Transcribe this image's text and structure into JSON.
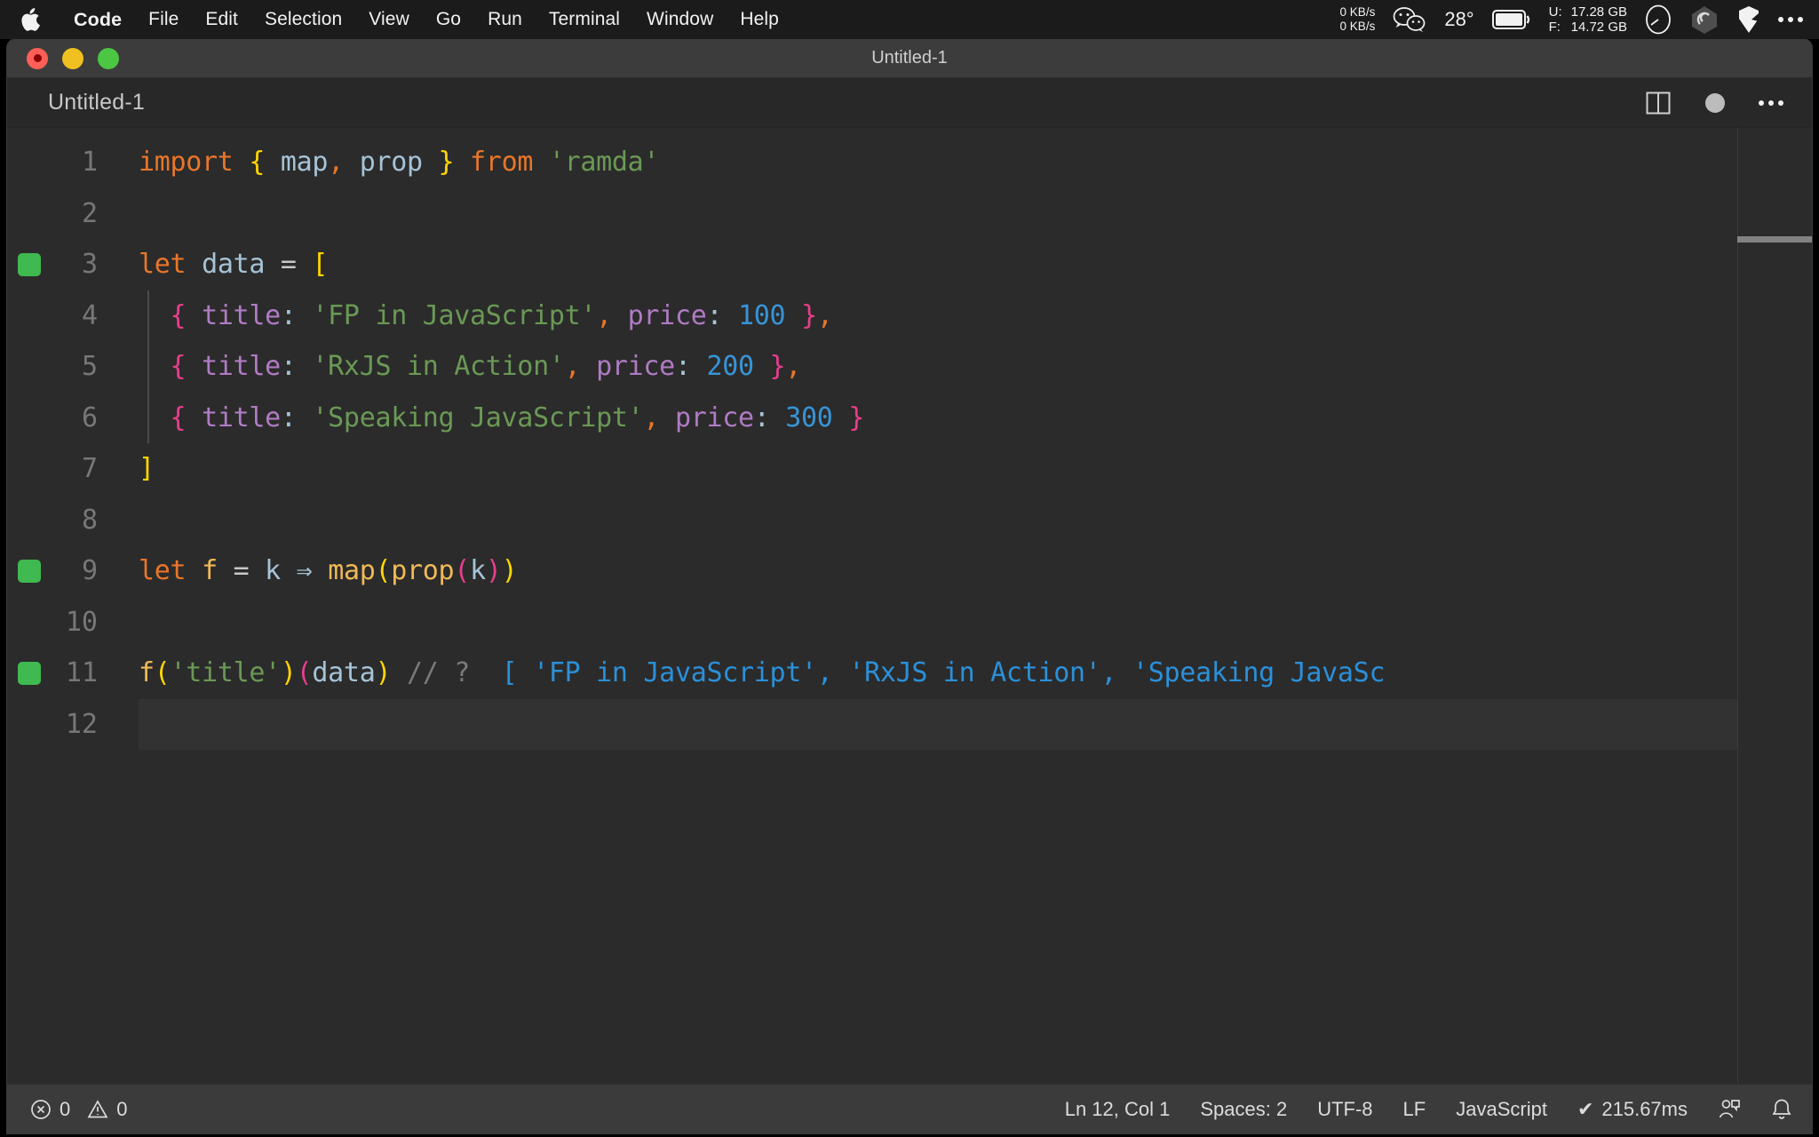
{
  "menubar": {
    "apple_icon": "apple-logo-icon",
    "items": [
      {
        "label": "Code",
        "bold": true
      },
      {
        "label": "File",
        "bold": false
      },
      {
        "label": "Edit",
        "bold": false
      },
      {
        "label": "Selection",
        "bold": false
      },
      {
        "label": "View",
        "bold": false
      },
      {
        "label": "Go",
        "bold": false
      },
      {
        "label": "Run",
        "bold": false
      },
      {
        "label": "Terminal",
        "bold": false
      },
      {
        "label": "Window",
        "bold": false
      },
      {
        "label": "Help",
        "bold": false
      }
    ],
    "status": {
      "net_up": "0 KB/s",
      "net_down": "0 KB/s",
      "wechat_icon": "wechat-icon",
      "temperature": "28°",
      "battery_icon": "battery-icon",
      "mem_used_label": "U:",
      "mem_used_value": "17.28 GB",
      "mem_free_label": "F:",
      "mem_free_value": "14.72 GB",
      "gauge_icon": "gauge-icon",
      "swirl_icon": "swirl-icon",
      "shield_icon": "shield-icon",
      "more_icon": "ellipsis-icon"
    }
  },
  "window": {
    "title": "Untitled-1",
    "traffic_lights": [
      {
        "name": "close-button",
        "color": "#ff5f57"
      },
      {
        "name": "minimize-button",
        "color": "#f0c020"
      },
      {
        "name": "maximize-button",
        "color": "#4cc744"
      }
    ]
  },
  "tabbar": {
    "tab_label": "Untitled-1",
    "split_editor_icon": "split-editor-icon",
    "dirty_indicator": "unsaved-dot-icon",
    "more_actions_icon": "ellipsis-icon"
  },
  "editor": {
    "lines": [
      {
        "number": "1",
        "marker": "",
        "indent_guide": false,
        "current": false,
        "tokens": [
          {
            "t": "import",
            "c": "kw"
          },
          {
            "t": " ",
            "c": "op"
          },
          {
            "t": "{",
            "c": "br-y"
          },
          {
            "t": " ",
            "c": "op"
          },
          {
            "t": "map",
            "c": "ident"
          },
          {
            "t": ",",
            "c": "kw"
          },
          {
            "t": " ",
            "c": "op"
          },
          {
            "t": "prop",
            "c": "ident"
          },
          {
            "t": " ",
            "c": "op"
          },
          {
            "t": "}",
            "c": "br-y"
          },
          {
            "t": " ",
            "c": "op"
          },
          {
            "t": "from",
            "c": "kw"
          },
          {
            "t": " ",
            "c": "op"
          },
          {
            "t": "'ramda'",
            "c": "str"
          }
        ]
      },
      {
        "number": "2",
        "marker": "",
        "indent_guide": false,
        "current": false,
        "tokens": []
      },
      {
        "number": "3",
        "marker": "green",
        "indent_guide": false,
        "current": false,
        "tokens": [
          {
            "t": "let",
            "c": "kw"
          },
          {
            "t": " ",
            "c": "op"
          },
          {
            "t": "data",
            "c": "ident"
          },
          {
            "t": " ",
            "c": "op"
          },
          {
            "t": "=",
            "c": "op"
          },
          {
            "t": " ",
            "c": "op"
          },
          {
            "t": "[",
            "c": "br-y"
          }
        ]
      },
      {
        "number": "4",
        "marker": "",
        "indent_guide": true,
        "current": false,
        "tokens": [
          {
            "t": "  ",
            "c": "op"
          },
          {
            "t": "{",
            "c": "br-m"
          },
          {
            "t": " ",
            "c": "op"
          },
          {
            "t": "title",
            "c": "prop"
          },
          {
            "t": ":",
            "c": "colon"
          },
          {
            "t": " ",
            "c": "op"
          },
          {
            "t": "'FP in JavaScript'",
            "c": "str"
          },
          {
            "t": ",",
            "c": "kw"
          },
          {
            "t": " ",
            "c": "op"
          },
          {
            "t": "price",
            "c": "prop"
          },
          {
            "t": ":",
            "c": "colon"
          },
          {
            "t": " ",
            "c": "op"
          },
          {
            "t": "100",
            "c": "num"
          },
          {
            "t": " ",
            "c": "op"
          },
          {
            "t": "}",
            "c": "br-m"
          },
          {
            "t": ",",
            "c": "kw"
          }
        ]
      },
      {
        "number": "5",
        "marker": "",
        "indent_guide": true,
        "current": false,
        "tokens": [
          {
            "t": "  ",
            "c": "op"
          },
          {
            "t": "{",
            "c": "br-m"
          },
          {
            "t": " ",
            "c": "op"
          },
          {
            "t": "title",
            "c": "prop"
          },
          {
            "t": ":",
            "c": "colon"
          },
          {
            "t": " ",
            "c": "op"
          },
          {
            "t": "'RxJS in Action'",
            "c": "str"
          },
          {
            "t": ",",
            "c": "kw"
          },
          {
            "t": " ",
            "c": "op"
          },
          {
            "t": "price",
            "c": "prop"
          },
          {
            "t": ":",
            "c": "colon"
          },
          {
            "t": " ",
            "c": "op"
          },
          {
            "t": "200",
            "c": "num"
          },
          {
            "t": " ",
            "c": "op"
          },
          {
            "t": "}",
            "c": "br-m"
          },
          {
            "t": ",",
            "c": "kw"
          }
        ]
      },
      {
        "number": "6",
        "marker": "",
        "indent_guide": true,
        "current": false,
        "tokens": [
          {
            "t": "  ",
            "c": "op"
          },
          {
            "t": "{",
            "c": "br-m"
          },
          {
            "t": " ",
            "c": "op"
          },
          {
            "t": "title",
            "c": "prop"
          },
          {
            "t": ":",
            "c": "colon"
          },
          {
            "t": " ",
            "c": "op"
          },
          {
            "t": "'Speaking JavaScript'",
            "c": "str"
          },
          {
            "t": ",",
            "c": "kw"
          },
          {
            "t": " ",
            "c": "op"
          },
          {
            "t": "price",
            "c": "prop"
          },
          {
            "t": ":",
            "c": "colon"
          },
          {
            "t": " ",
            "c": "op"
          },
          {
            "t": "300",
            "c": "num"
          },
          {
            "t": " ",
            "c": "op"
          },
          {
            "t": "}",
            "c": "br-m"
          }
        ]
      },
      {
        "number": "7",
        "marker": "",
        "indent_guide": false,
        "current": false,
        "tokens": [
          {
            "t": "]",
            "c": "br-y"
          }
        ]
      },
      {
        "number": "8",
        "marker": "",
        "indent_guide": false,
        "current": false,
        "tokens": []
      },
      {
        "number": "9",
        "marker": "green",
        "indent_guide": false,
        "current": false,
        "tokens": [
          {
            "t": "let",
            "c": "kw"
          },
          {
            "t": " ",
            "c": "op"
          },
          {
            "t": "f",
            "c": "fn"
          },
          {
            "t": " ",
            "c": "op"
          },
          {
            "t": "=",
            "c": "op"
          },
          {
            "t": " ",
            "c": "op"
          },
          {
            "t": "k",
            "c": "ident"
          },
          {
            "t": " ",
            "c": "op"
          },
          {
            "t": "⇒",
            "c": "arrow"
          },
          {
            "t": " ",
            "c": "op"
          },
          {
            "t": "map",
            "c": "fn"
          },
          {
            "t": "(",
            "c": "br-y"
          },
          {
            "t": "prop",
            "c": "fn"
          },
          {
            "t": "(",
            "c": "br-m"
          },
          {
            "t": "k",
            "c": "ident"
          },
          {
            "t": ")",
            "c": "br-m"
          },
          {
            "t": ")",
            "c": "br-y"
          }
        ]
      },
      {
        "number": "10",
        "marker": "",
        "indent_guide": false,
        "current": false,
        "tokens": []
      },
      {
        "number": "11",
        "marker": "green",
        "indent_guide": false,
        "current": false,
        "tokens": [
          {
            "t": "f",
            "c": "fn"
          },
          {
            "t": "(",
            "c": "br-y"
          },
          {
            "t": "'title'",
            "c": "str"
          },
          {
            "t": ")",
            "c": "br-y"
          },
          {
            "t": "(",
            "c": "br-m"
          },
          {
            "t": "data",
            "c": "ident"
          },
          {
            "t": ")",
            "c": "br-y"
          },
          {
            "t": " ",
            "c": "op"
          },
          {
            "t": "// ?",
            "c": "cmt"
          },
          {
            "t": "  ",
            "c": "op"
          },
          {
            "t": "[ 'FP in JavaScript', 'RxJS in Action', 'Speaking JavaSc",
            "c": "out"
          }
        ]
      },
      {
        "number": "12",
        "marker": "",
        "indent_guide": false,
        "current": true,
        "tokens": []
      }
    ],
    "minimap_icon": "minimap-scrollbar"
  },
  "statusbar": {
    "errors_icon": "error-circle-icon",
    "errors_count": "0",
    "warnings_icon": "warning-triangle-icon",
    "warnings_count": "0",
    "cursor_position": "Ln 12, Col 1",
    "indentation": "Spaces: 2",
    "encoding": "UTF-8",
    "eol": "LF",
    "language": "JavaScript",
    "runtime_check": "✔",
    "runtime": "215.67ms",
    "feedback_icon": "feedback-person-icon",
    "bell_icon": "bell-icon"
  }
}
